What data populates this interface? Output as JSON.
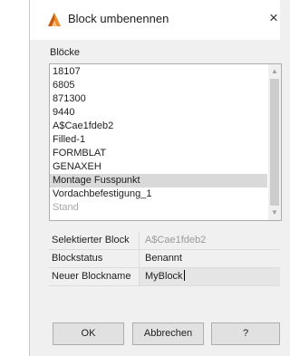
{
  "dialog": {
    "title": "Block umbenennen",
    "icon": "autocad-icon",
    "close_label": "×"
  },
  "blocks": {
    "label": "Blöcke",
    "items": [
      "18107",
      "6805",
      "871300",
      "9440",
      "A$Cae1fdeb2",
      "Filled-1",
      "FORMBLAT",
      "GENAXEH",
      "Montage Fusspunkt",
      "Vordachbefestigung_1",
      "Stand"
    ],
    "selected": "Montage Fusspunkt",
    "scroll_up": "▲",
    "scroll_down": "▼"
  },
  "properties": {
    "selected_block": {
      "label": "Selektierter Block",
      "value": "A$Cae1fdeb2"
    },
    "block_status": {
      "label": "Blockstatus",
      "value": "Benannt"
    },
    "new_name": {
      "label": "Neuer Blockname",
      "value": "MyBlock"
    }
  },
  "buttons": {
    "ok": "OK",
    "cancel": "Abbrechen",
    "help": "?"
  },
  "colors": {
    "accent": "#e07020",
    "selected_row": "#d9d9d9"
  }
}
